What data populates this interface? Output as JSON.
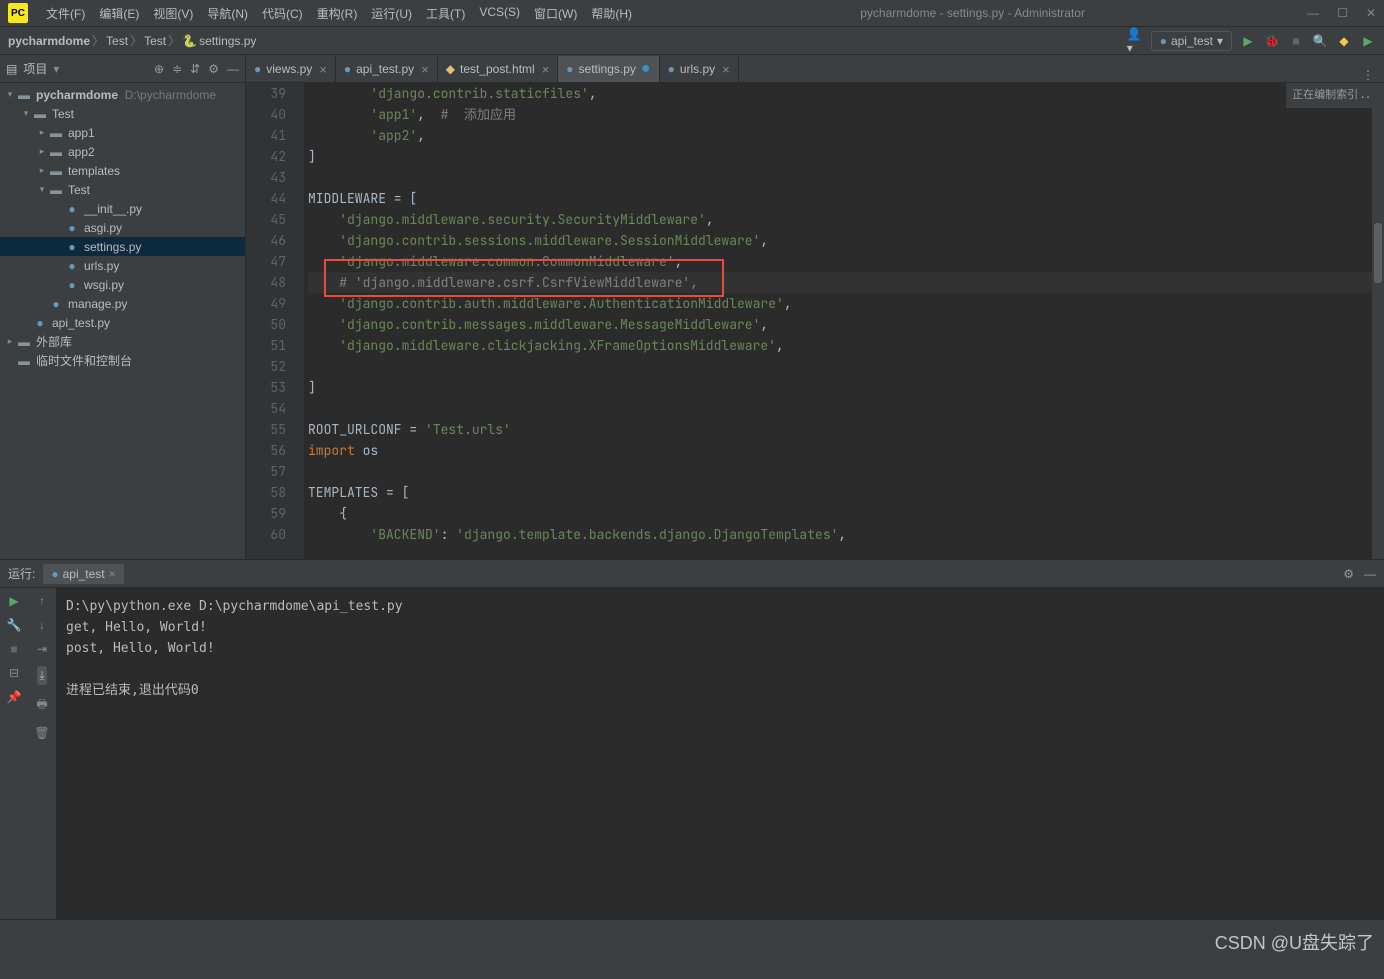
{
  "title": "pycharmdome - settings.py - Administrator",
  "menus": [
    "文件(F)",
    "编辑(E)",
    "视图(V)",
    "导航(N)",
    "代码(C)",
    "重构(R)",
    "运行(U)",
    "工具(T)",
    "VCS(S)",
    "窗口(W)",
    "帮助(H)"
  ],
  "breadcrumb": {
    "root": "pycharmdome",
    "p1": "Test",
    "p2": "Test",
    "file": "settings.py"
  },
  "run_config": "api_test",
  "indexing": "正在编制索引...",
  "proj_header": "项目",
  "tree": {
    "root": {
      "name": "pycharmdome",
      "path": "D:\\pycharmdome"
    },
    "test_outer": "Test",
    "app1": "app1",
    "app2": "app2",
    "templates": "templates",
    "test_inner": "Test",
    "files": [
      "__init__.py",
      "asgi.py",
      "settings.py",
      "urls.py",
      "wsgi.py"
    ],
    "manage": "manage.py",
    "apitest": "api_test.py",
    "extlib": "外部库",
    "scratch": "临时文件和控制台"
  },
  "tabs": [
    {
      "label": "views.py",
      "icon": "py"
    },
    {
      "label": "api_test.py",
      "icon": "py"
    },
    {
      "label": "test_post.html",
      "icon": "html"
    },
    {
      "label": "settings.py",
      "icon": "py",
      "active": true,
      "dirty": true
    },
    {
      "label": "urls.py",
      "icon": "py"
    }
  ],
  "code": {
    "start": 39,
    "lines": [
      {
        "n": 39,
        "t": "        'django.contrib.staticfiles',",
        "cls": "s-str"
      },
      {
        "n": 40,
        "t": "        'app1',  #  添加应用",
        "mix": true,
        "pre": "        ",
        "str": "'app1'",
        "sep": ",  ",
        "com": "#  添加应用"
      },
      {
        "n": 41,
        "t": "        'app2',",
        "cls": "s-str"
      },
      {
        "n": 42,
        "t": "]"
      },
      {
        "n": 43,
        "t": ""
      },
      {
        "n": 44,
        "t": "MIDDLEWARE = ["
      },
      {
        "n": 45,
        "t": "    'django.middleware.security.SecurityMiddleware',",
        "cls": "s-str"
      },
      {
        "n": 46,
        "t": "    'django.contrib.sessions.middleware.SessionMiddleware',",
        "cls": "s-str"
      },
      {
        "n": 47,
        "t": "    'django.middleware.common.CommonMiddleware',",
        "cls": "s-str"
      },
      {
        "n": 48,
        "t": "    # 'django.middleware.csrf.CsrfViewMiddleware',",
        "cls": "s-com",
        "cur": true
      },
      {
        "n": 49,
        "t": "    'django.contrib.auth.middleware.AuthenticationMiddleware',",
        "cls": "s-str"
      },
      {
        "n": 50,
        "t": "    'django.contrib.messages.middleware.MessageMiddleware',",
        "cls": "s-str"
      },
      {
        "n": 51,
        "t": "    'django.middleware.clickjacking.XFrameOptionsMiddleware',",
        "cls": "s-str"
      },
      {
        "n": 52,
        "t": ""
      },
      {
        "n": 53,
        "t": "]"
      },
      {
        "n": 54,
        "t": ""
      },
      {
        "n": 55,
        "t": "ROOT_URLCONF = 'Test.urls'",
        "mix": true,
        "var": "ROOT_URLCONF",
        "eq": " = ",
        "str": "'Test.urls'"
      },
      {
        "n": 56,
        "t": "import os",
        "kw": "import",
        "rest": " os"
      },
      {
        "n": 57,
        "t": ""
      },
      {
        "n": 58,
        "t": "TEMPLATES = ["
      },
      {
        "n": 59,
        "t": "    {"
      },
      {
        "n": 60,
        "t": "        'BACKEND': 'django.template.backends.django.DjangoTemplates',",
        "mix": true,
        "pre": "        ",
        "str": "'BACKEND'",
        "sep": ": ",
        "str2": "'django.template.backends.django.DjangoTemplates'",
        "tail": ","
      }
    ]
  },
  "run": {
    "label": "运行:",
    "tab": "api_test",
    "lines": [
      "D:\\py\\python.exe D:\\pycharmdome\\api_test.py",
      "get, Hello, World!",
      "post, Hello, World!",
      "",
      "进程已结束,退出代码0"
    ]
  },
  "watermark": "CSDN @U盘失踪了"
}
